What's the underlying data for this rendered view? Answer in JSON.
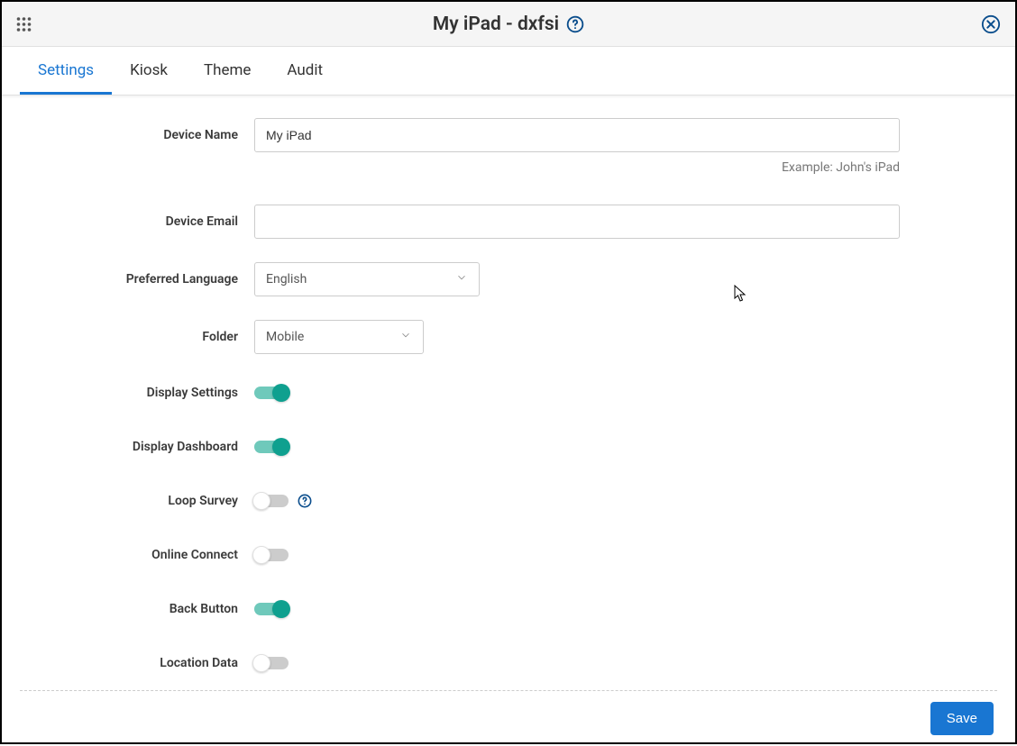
{
  "header": {
    "title": "My iPad - dxfsi"
  },
  "tabs": {
    "items": [
      {
        "label": "Settings",
        "active": true
      },
      {
        "label": "Kiosk",
        "active": false
      },
      {
        "label": "Theme",
        "active": false
      },
      {
        "label": "Audit",
        "active": false
      }
    ]
  },
  "form": {
    "device_name": {
      "label": "Device Name",
      "value": "My iPad",
      "hint": "Example: John's iPad"
    },
    "device_email": {
      "label": "Device Email",
      "value": ""
    },
    "preferred_language": {
      "label": "Preferred Language",
      "value": "English"
    },
    "folder": {
      "label": "Folder",
      "value": "Mobile"
    },
    "display_settings": {
      "label": "Display Settings",
      "on": true
    },
    "display_dashboard": {
      "label": "Display Dashboard",
      "on": true
    },
    "loop_survey": {
      "label": "Loop Survey",
      "on": false
    },
    "online_connect": {
      "label": "Online Connect",
      "on": false
    },
    "back_button": {
      "label": "Back Button",
      "on": true
    },
    "location_data": {
      "label": "Location Data",
      "on": false
    }
  },
  "footer": {
    "save_label": "Save"
  }
}
